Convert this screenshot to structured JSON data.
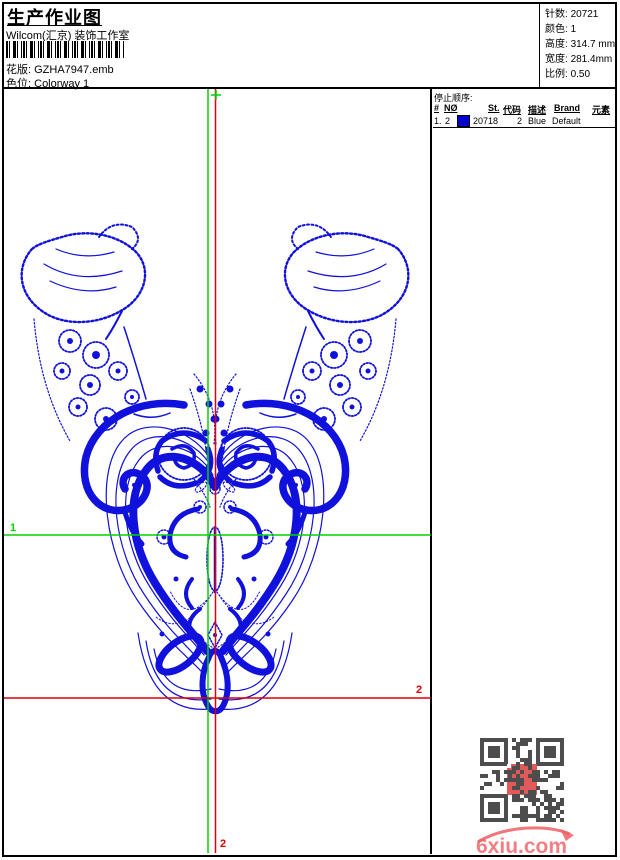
{
  "header": {
    "title": "生产作业图",
    "subtitle": "Wilcom(汇京) 装饰工作室",
    "pattern_label": "花版:",
    "pattern_value": "GZHA7947.emb",
    "colorway_label": "色位:",
    "colorway_value": "Colorway 1"
  },
  "info_box": {
    "rows": [
      {
        "label": "针数:",
        "value": "20721"
      },
      {
        "label": "颜色:",
        "value": "1"
      },
      {
        "label": "高度:",
        "value": "314.7 mm"
      },
      {
        "label": "宽度:",
        "value": "281.4mm"
      },
      {
        "label": "比例:",
        "value": "0.50"
      }
    ]
  },
  "stop_sequence": {
    "title": "停止顺序:",
    "columns": {
      "hash": "#",
      "no": "NØ",
      "st": "St.",
      "code": "代码",
      "description": "描述",
      "brand": "Brand",
      "elements": "元素"
    },
    "rows": [
      {
        "index": "1.",
        "no": "2",
        "swatch_color": "#0000cc",
        "st": "20718",
        "code": "2",
        "description": "Blue",
        "brand": "Default",
        "elements": ""
      }
    ]
  },
  "guides": {
    "green_color": "#00d300",
    "red_color": "#e00000",
    "label_green_1": "1",
    "label_red_right": "2",
    "label_red_bottom": "2"
  },
  "design": {
    "thread_color": "#1111dd",
    "description": "symmetric blue lace collar embroidery"
  },
  "watermark": {
    "text": "6xiu.com",
    "color": "#ef5f66"
  }
}
